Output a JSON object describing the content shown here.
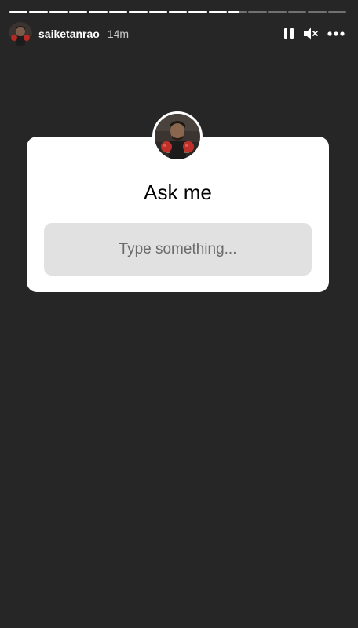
{
  "story": {
    "segments_total": 17,
    "segments_done": 11,
    "current_segment_progress": 0.6,
    "colors": {
      "background": "#262626",
      "card": "#ffffff",
      "input_bg": "#e1e1e1"
    }
  },
  "header": {
    "username": "saiketanrao",
    "time": "14m",
    "icons": [
      "avatar",
      "pause-icon",
      "mute-icon",
      "more-icon"
    ]
  },
  "question_sticker": {
    "title": "Ask me",
    "input_placeholder": "Type something..."
  }
}
